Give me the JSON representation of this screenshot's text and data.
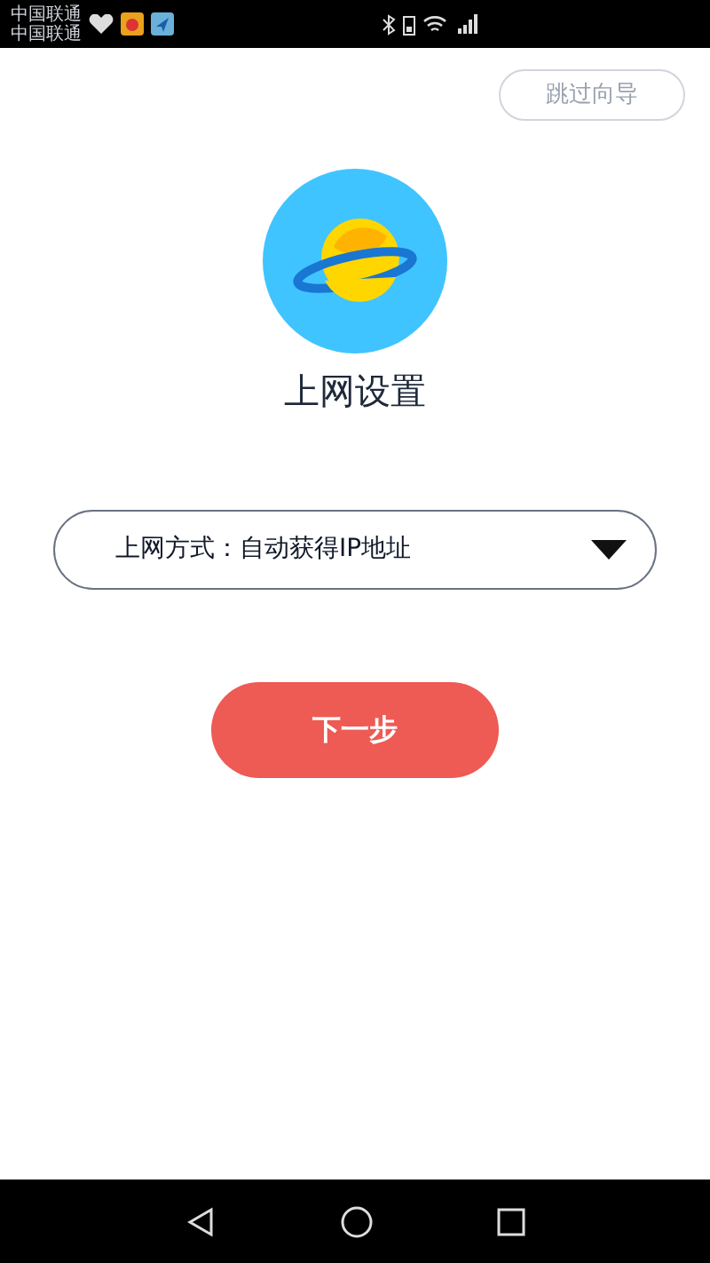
{
  "status_bar": {
    "carriers": [
      "中国联通",
      "中国联通"
    ]
  },
  "skip_button": "跳过向导",
  "title": "上网设置",
  "connection_select": {
    "value": "上网方式：自动获得IP地址"
  },
  "next_button": "下一步"
}
